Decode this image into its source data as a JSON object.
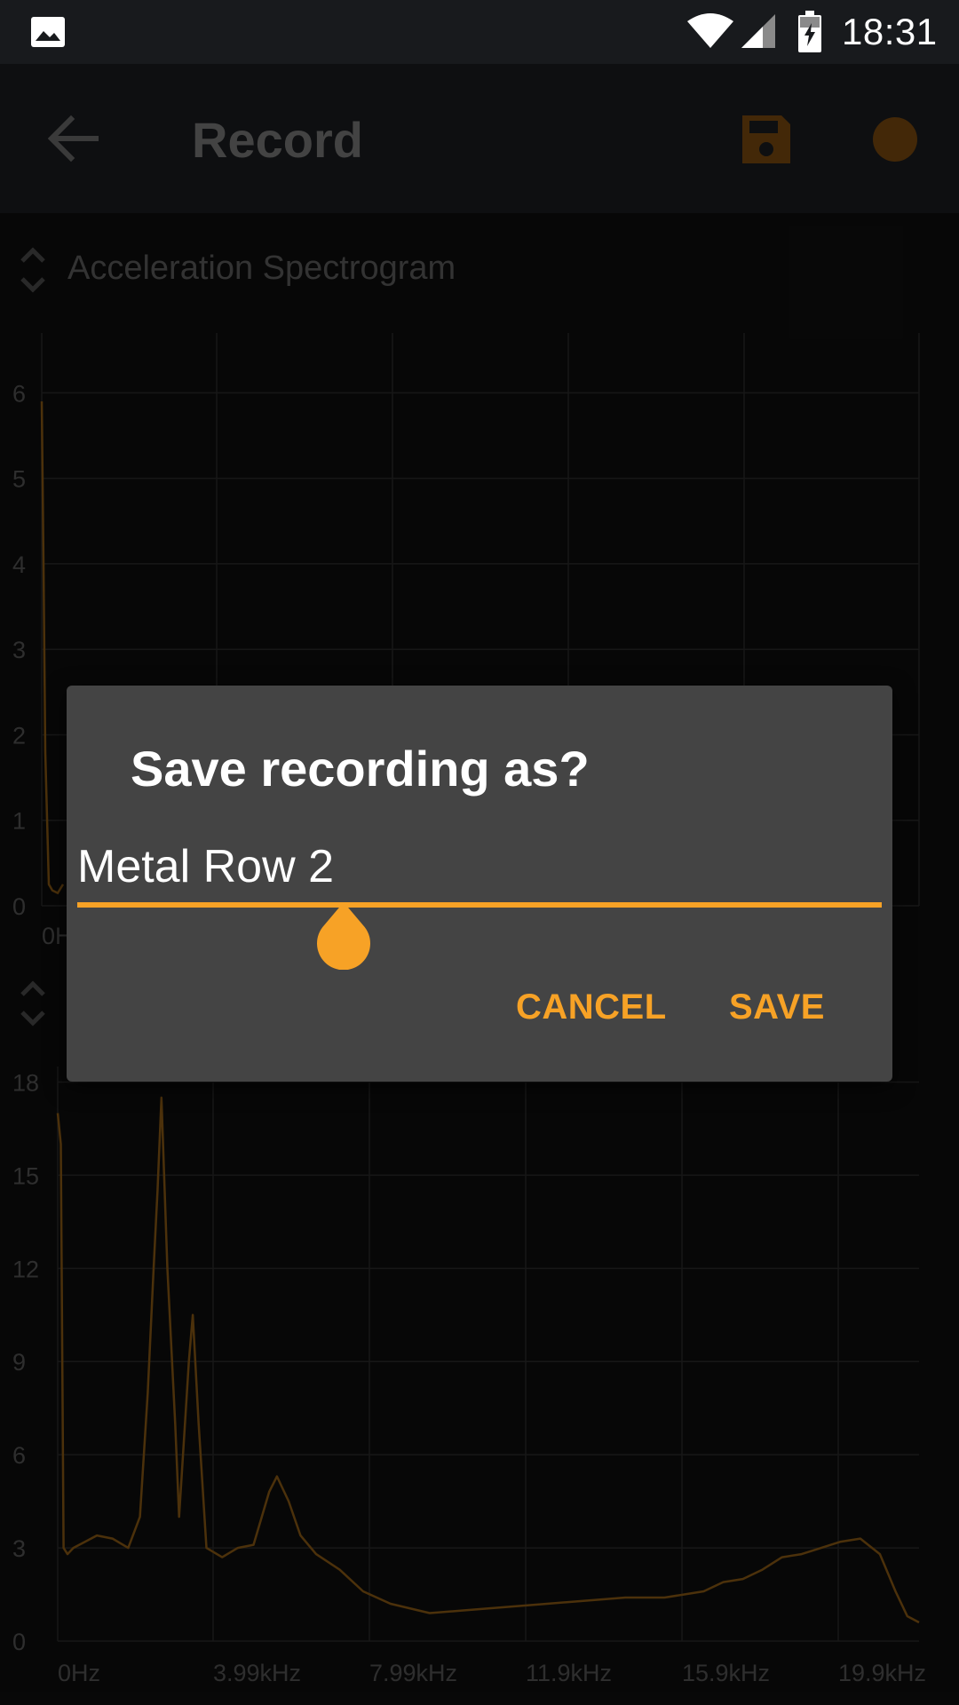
{
  "status_bar": {
    "time": "18:31",
    "icons": [
      "gallery-icon",
      "wifi-icon",
      "cell-signal-icon",
      "battery-charging-icon"
    ]
  },
  "app_bar": {
    "title": "Record",
    "icons": [
      "back-arrow-icon",
      "save-icon",
      "record-icon"
    ],
    "accent_color": "#f7a226"
  },
  "top_chart": {
    "label": "Acceleration Spectrogram",
    "y_ticks": [
      "0",
      "1",
      "2",
      "3",
      "4",
      "5",
      "6"
    ],
    "x_tick_visible": "0H"
  },
  "bottom_chart": {
    "y_ticks": [
      "0",
      "3",
      "6",
      "9",
      "12",
      "15",
      "18"
    ],
    "x_ticks": [
      "0Hz",
      "3.99kHz",
      "7.99kHz",
      "11.9kHz",
      "15.9kHz",
      "19.9kHz"
    ]
  },
  "dialog": {
    "title": "Save recording as?",
    "input_value": "Metal Row 2",
    "cancel_label": "CANCEL",
    "save_label": "SAVE"
  },
  "chart_data": [
    {
      "type": "line",
      "title": "Acceleration Spectrogram",
      "xlabel": "",
      "ylabel": "",
      "ylim": [
        0,
        6.7
      ],
      "grid": true,
      "color": "#8a5a14",
      "x": [
        0,
        0.05,
        0.1,
        0.2,
        0.3,
        0.45,
        0.6
      ],
      "y": [
        5.9,
        4.0,
        1.8,
        0.25,
        0.18,
        0.15,
        0.25
      ]
    },
    {
      "type": "line",
      "title": "",
      "xlabel": "",
      "ylabel": "",
      "xlim": [
        0,
        22000
      ],
      "ylim": [
        0,
        18.5
      ],
      "grid": true,
      "color": "#8a5a14",
      "x": [
        0,
        80,
        150,
        250,
        400,
        700,
        1000,
        1400,
        1800,
        2100,
        2300,
        2450,
        2550,
        2650,
        2800,
        3000,
        3100,
        3200,
        3350,
        3450,
        3600,
        3800,
        4200,
        4600,
        5000,
        5400,
        5600,
        5900,
        6200,
        6600,
        7200,
        7800,
        8500,
        9500,
        10500,
        11500,
        12500,
        13500,
        14500,
        15500,
        16500,
        17000,
        17500,
        18000,
        18500,
        19000,
        19500,
        20000,
        20500,
        21000,
        21400,
        21700,
        22000
      ],
      "y": [
        17.0,
        16.0,
        3.0,
        2.8,
        3.0,
        3.2,
        3.4,
        3.3,
        3.0,
        4.0,
        8.0,
        12.0,
        14.5,
        17.5,
        12.0,
        7.0,
        4.0,
        6.0,
        9.0,
        10.5,
        7.0,
        3.0,
        2.7,
        3.0,
        3.1,
        4.8,
        5.3,
        4.5,
        3.4,
        2.8,
        2.3,
        1.6,
        1.2,
        0.9,
        1.0,
        1.1,
        1.2,
        1.3,
        1.4,
        1.4,
        1.6,
        1.9,
        2.0,
        2.3,
        2.7,
        2.8,
        3.0,
        3.2,
        3.3,
        2.8,
        1.6,
        0.8,
        0.6
      ]
    }
  ]
}
